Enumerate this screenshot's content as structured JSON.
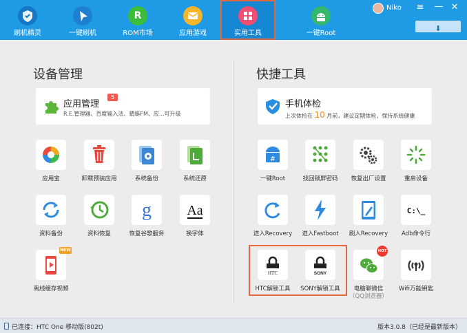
{
  "nav": [
    {
      "label": "刷机精灵"
    },
    {
      "label": "一键刷机"
    },
    {
      "label": "ROM市场"
    },
    {
      "label": "应用游戏"
    },
    {
      "label": "实用工具"
    },
    {
      "label": "一键Root"
    }
  ],
  "user": {
    "name": "Niko"
  },
  "icons": {
    "menu": "≡",
    "minimize": "—",
    "close": "✕",
    "download": "⬇"
  },
  "sections": {
    "device": "设备管理",
    "quick": "快捷工具"
  },
  "app_manager": {
    "title": "应用管理",
    "badge": "5",
    "subtitle": "R.E.管理器、百度输入法、蜻蜓FM、应...可升级"
  },
  "health_check": {
    "title": "手机体检",
    "sub_before": "上次体检在",
    "days": "10",
    "sub_after": "月前，建议定期体检，保持系统健康"
  },
  "device_tools": [
    {
      "label": "应用宝"
    },
    {
      "label": "卸载预装应用"
    },
    {
      "label": "系统备份"
    },
    {
      "label": "系统还原"
    },
    {
      "label": "资料备份"
    },
    {
      "label": "资料恢复"
    },
    {
      "label": "恢复谷歌服务"
    },
    {
      "label": "换字体"
    },
    {
      "label": "离线缓存视频",
      "badge": "NEW"
    }
  ],
  "quick_tools": [
    {
      "label": "一键Root"
    },
    {
      "label": "找回锁屏密码"
    },
    {
      "label": "恢复出厂设置"
    },
    {
      "label": "重启设备"
    },
    {
      "label": "进入Recovery"
    },
    {
      "label": "进入Fastboot"
    },
    {
      "label": "刷入Recovery"
    },
    {
      "label": "Adb命令行",
      "icon_text": "C:\\_"
    },
    {
      "label": "HTC解锁工具",
      "icon_text": "HTC"
    },
    {
      "label": "SONY解锁工具",
      "icon_text": "SONY"
    },
    {
      "label": "电脑聊微信",
      "sublabel": "（QQ浏览器）",
      "badge": "HOT"
    },
    {
      "label": "Wifi万能钥匙"
    }
  ],
  "font_icon_text": "Aa",
  "google_icon_text": "g",
  "status": {
    "connection": "已连接：HTC One 移动版(802t)",
    "version": "版本3.0.8（已经是最新版本）"
  },
  "colors": {
    "topbar": "#1f9be6",
    "highlight": "#e8663a",
    "accent_orange": "#f08a1c"
  }
}
